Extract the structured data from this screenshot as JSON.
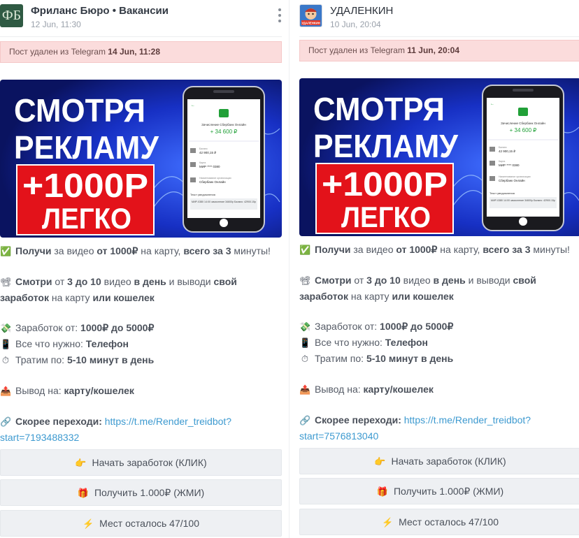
{
  "posts": [
    {
      "channel": "Фриланс Бюро • Вакансии",
      "avatar_text": "ФБ",
      "date": "12 Jun, 11:30",
      "deleted_prefix": "Пост удален из Telegram",
      "deleted_date": "14 Jun, 11:28",
      "link_text": "https://t.me/Render_treidbot?start=7193488332"
    },
    {
      "channel": "УДАЛЕНКИН",
      "avatar_text": "УДАЛЕНКИН",
      "date": "10 Jun, 20:04",
      "deleted_prefix": "Пост удален из Telegram",
      "deleted_date": "11 Jun, 20:04",
      "link_text": "https://t.me/Render_treidbot?start=7576813040"
    }
  ],
  "banner": {
    "line1": "СМОТРЯ",
    "line2": "РЕКЛАМУ",
    "line3": "+1000Р",
    "line4": "ЛЕГКО",
    "phone_title": "Зачисление Сбербанк Онлайн",
    "phone_amount": "+ 34 600 ₽",
    "phone_row1_label": "Баланс",
    "phone_row1_value": "42 900,15 ₽",
    "phone_row2_label": "Карта",
    "phone_row2_value": "МИР **** 0380",
    "phone_row3_label": "Наименование организации",
    "phone_row3_value": "Сбербанк Онлайн",
    "phone_text_label": "Текст уведомления",
    "phone_text_value": "МИР-0380 14:00 зачисление 34600р Баланс: 42900.15р"
  },
  "message": {
    "l1_icon": "✅",
    "l1_a": "Получи",
    "l1_b": " за видео ",
    "l1_c": "от 1000₽",
    "l1_d": " на карту, ",
    "l1_e": "всего за 3",
    "l1_f": " минуты!",
    "l2_icon": "📽",
    "l2_a": "Смотри",
    "l2_b": " от ",
    "l2_c": "3 до 10",
    "l2_d": " видео ",
    "l2_e": "в день",
    "l2_f": " и выводи ",
    "l2_g": "свой заработок",
    "l2_h": " на карту ",
    "l2_i": "или кошелек",
    "l3_icon": "💸",
    "l3_a": "Заработок от: ",
    "l3_b": "1000₽ до 5000₽",
    "l4_icon": "📱",
    "l4_a": "Все что нужно: ",
    "l4_b": "Телефон",
    "l5_icon": "⏱",
    "l5_a": "Тратим по: ",
    "l5_b": "5-10 минут в день",
    "l6_icon": "📤",
    "l6_a": "Вывод на: ",
    "l6_b": "карту/кошелек",
    "l7_icon": "🔗",
    "l7_a": "Скорее переходи:"
  },
  "buttons": [
    {
      "icon": "👉",
      "label": "Начать заработок (КЛИК)"
    },
    {
      "icon": "🎁",
      "label": "Получить 1.000₽ (ЖМИ)"
    },
    {
      "icon": "⚡",
      "label": "Мест осталось 47/100"
    }
  ],
  "colors": {
    "deleted_bg": "#fbdcdc",
    "button_bg": "#eef0f3",
    "link": "#3d9ad0",
    "banner_blue": "#1330c8",
    "banner_red": "#e3121a"
  }
}
